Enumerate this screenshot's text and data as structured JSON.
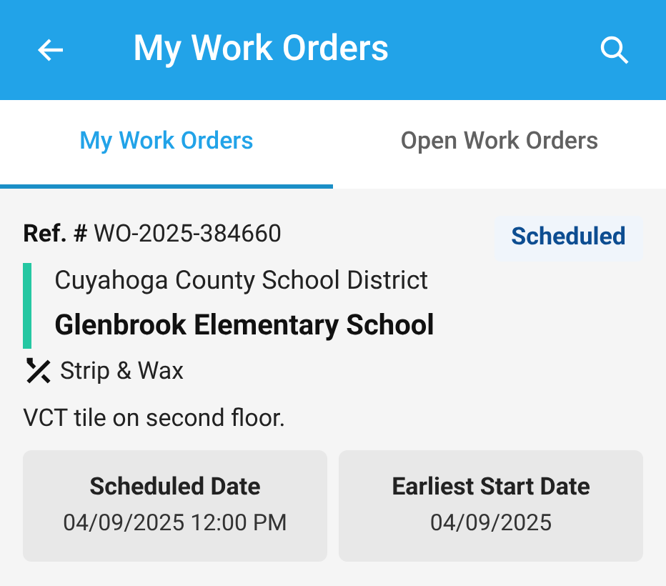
{
  "app_bar": {
    "title": "My Work Orders"
  },
  "tabs": [
    {
      "label": "My Work Orders",
      "selected": true
    },
    {
      "label": "Open Work Orders",
      "selected": false
    }
  ],
  "work_order": {
    "ref_label": "Ref. #",
    "ref": "WO-2025-384660",
    "status": "Scheduled",
    "customer": "Cuyahoga County School District",
    "site": "Glenbrook Elementary School",
    "service": "Strip & Wax",
    "description": "VCT tile on second floor.",
    "dates": [
      {
        "label": "Scheduled Date",
        "value": "04/09/2025 12:00 PM"
      },
      {
        "label": "Earliest Start Date",
        "value": "04/09/2025"
      }
    ]
  }
}
